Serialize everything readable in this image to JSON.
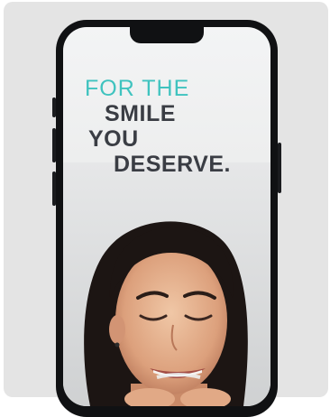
{
  "ad": {
    "headline_line1": "FOR THE",
    "headline_line2": "SMILE",
    "headline_line3": "YOU",
    "headline_line4": "DESERVE."
  },
  "colors": {
    "accent": "#3fc3bf",
    "headline_dark": "#3a3d44",
    "card_background": "#e4e4e4",
    "phone_frame": "#101113"
  },
  "icons": {
    "device": "smartphone-mockup"
  }
}
